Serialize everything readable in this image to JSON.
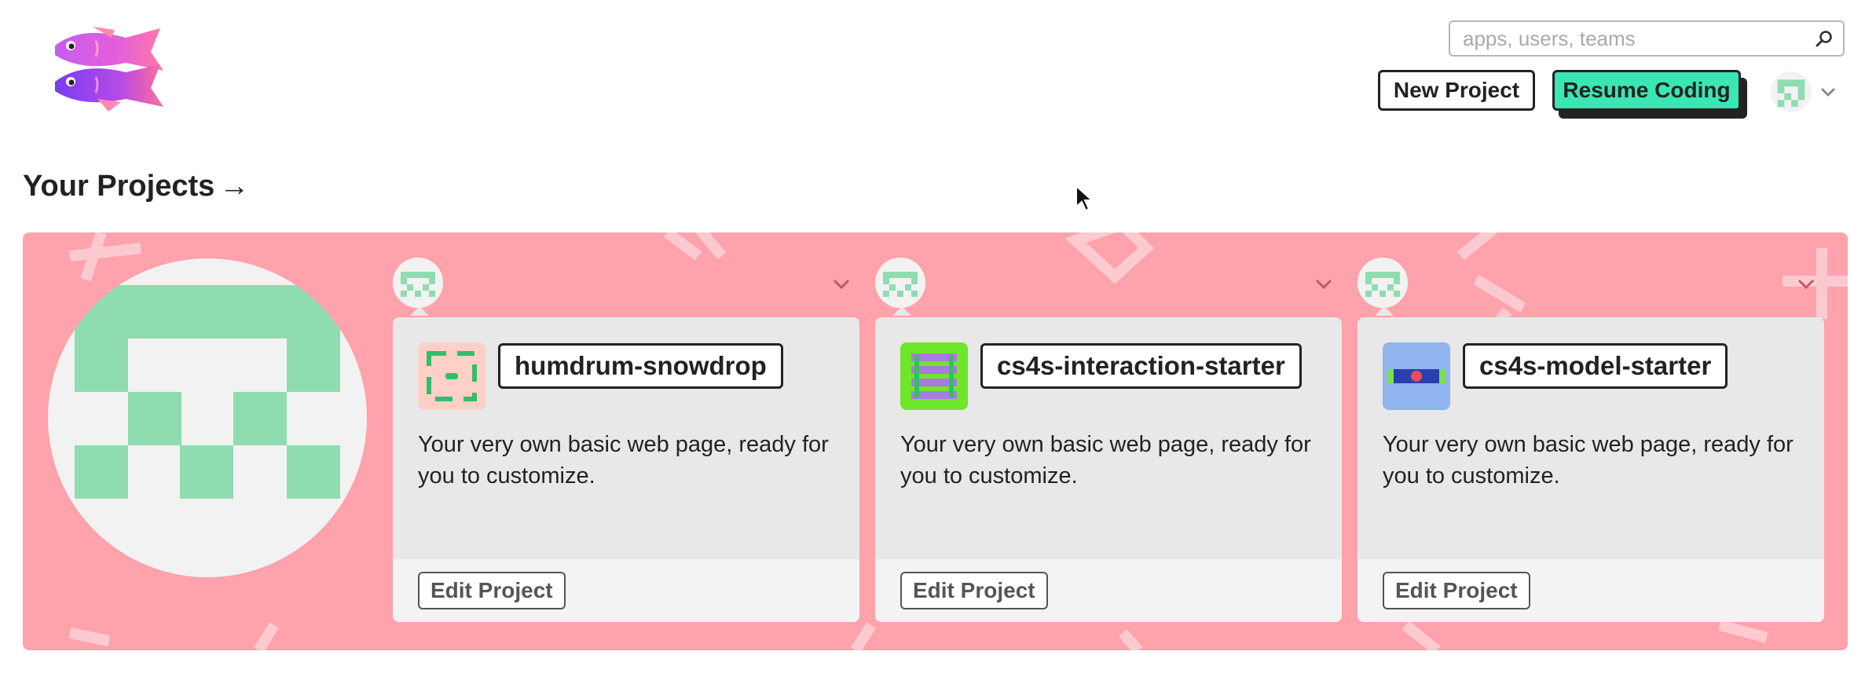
{
  "header": {
    "logo_icon": "glitch-fish-logo",
    "search": {
      "placeholder": "apps, users, teams",
      "value": "",
      "icon": "search-icon"
    },
    "new_project_label": "New Project",
    "resume_coding_label": "Resume Coding",
    "user_menu": {
      "avatar_icon": "pixel-avatar",
      "chevron_icon": "chevron-down-icon"
    }
  },
  "section": {
    "title": "Your Projects",
    "title_arrow": "→"
  },
  "colors": {
    "band_background": "#fea2ab",
    "resume_button": "#39e6b4",
    "avatar_green": "#8fdcb0",
    "avatar_light": "#f2f2f2",
    "card_background": "#e8e8e8",
    "card_footer": "#f3f3f3"
  },
  "projects": [
    {
      "name": "humdrum-snowdrop",
      "description": "Your very own basic web page, ready for you to customize.",
      "edit_label": "Edit Project",
      "icon": "project-icon-pink-square"
    },
    {
      "name": "cs4s-interaction-starter",
      "description": "Your very own basic web page, ready for you to customize.",
      "edit_label": "Edit Project",
      "icon": "project-icon-green-striped"
    },
    {
      "name": "cs4s-model-starter",
      "description": "Your very own basic web page, ready for you to customize.",
      "edit_label": "Edit Project",
      "icon": "project-icon-blue-bar"
    }
  ]
}
